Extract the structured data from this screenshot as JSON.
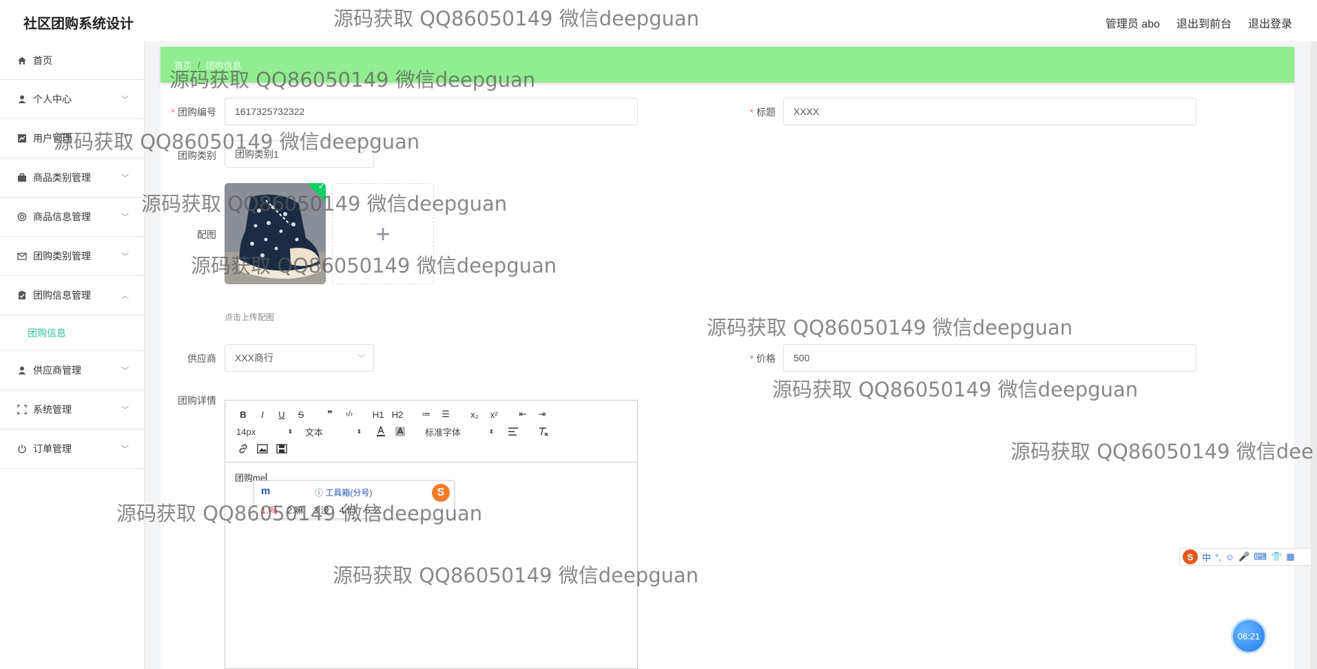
{
  "app": {
    "title": "社区团购系统设计"
  },
  "header": {
    "links": [
      "管理员 abo",
      "退出到前台",
      "退出登录"
    ]
  },
  "sidebar": {
    "items": [
      {
        "label": "首页",
        "icon": "home-icon",
        "expandable": false
      },
      {
        "label": "个人中心",
        "icon": "user-icon",
        "expandable": true
      },
      {
        "label": "用户管理",
        "icon": "chart-icon",
        "expandable": true
      },
      {
        "label": "商品类别管理",
        "icon": "briefcase-icon",
        "expandable": true
      },
      {
        "label": "商品信息管理",
        "icon": "circle-icon",
        "expandable": true
      },
      {
        "label": "团购类别管理",
        "icon": "mail-icon",
        "expandable": true
      },
      {
        "label": "团购信息管理",
        "icon": "clipboard-icon",
        "expandable": true,
        "expanded": true,
        "children": [
          "团购信息"
        ]
      },
      {
        "label": "供应商管理",
        "icon": "user-icon",
        "expandable": true
      },
      {
        "label": "系统管理",
        "icon": "frame-icon",
        "expandable": true
      },
      {
        "label": "订单管理",
        "icon": "power-icon",
        "expandable": true
      }
    ]
  },
  "breadcrumb": {
    "home": "首页",
    "separator": "/",
    "current": "团购信息"
  },
  "form": {
    "id": {
      "label": "团购编号",
      "value": "1617325732322",
      "required": true
    },
    "title": {
      "label": "标题",
      "value": "XXXX",
      "required": true
    },
    "category": {
      "label": "团购类别",
      "value": "团购类别1"
    },
    "image": {
      "label": "配图",
      "hint": "点击上传配图",
      "add": "+"
    },
    "supplier": {
      "label": "供应商",
      "value": "XXX商行"
    },
    "price": {
      "label": "价格",
      "value": "500",
      "required": true
    },
    "detail": {
      "label": "团购详情",
      "content": "团购me"
    }
  },
  "editor": {
    "row1": [
      "B",
      "I",
      "U",
      "S",
      "❞",
      "‹/›",
      "H1",
      "H2",
      "≔",
      "☰",
      "x₂",
      "x²",
      "⇤",
      "⇥"
    ],
    "font_size": "14px",
    "text_type": "文本",
    "font_family": "标准字体"
  },
  "ime_popup": {
    "input": "m",
    "tool": "ⓘ 工具箱(分号)",
    "candidates": [
      "1.吗",
      "2.嘛",
      "3.没",
      "4.们",
      "5.么"
    ],
    "logo": "S"
  },
  "ime_bar": {
    "items": [
      "S",
      "中",
      "°,",
      "☺",
      "🎤",
      "⌨",
      "👕",
      "▦"
    ]
  },
  "clock": "06:21",
  "watermark": "源码获取 QQ86050149 微信deepguan",
  "watermark_cut": "源码获取 QQ86050149 微信dee"
}
